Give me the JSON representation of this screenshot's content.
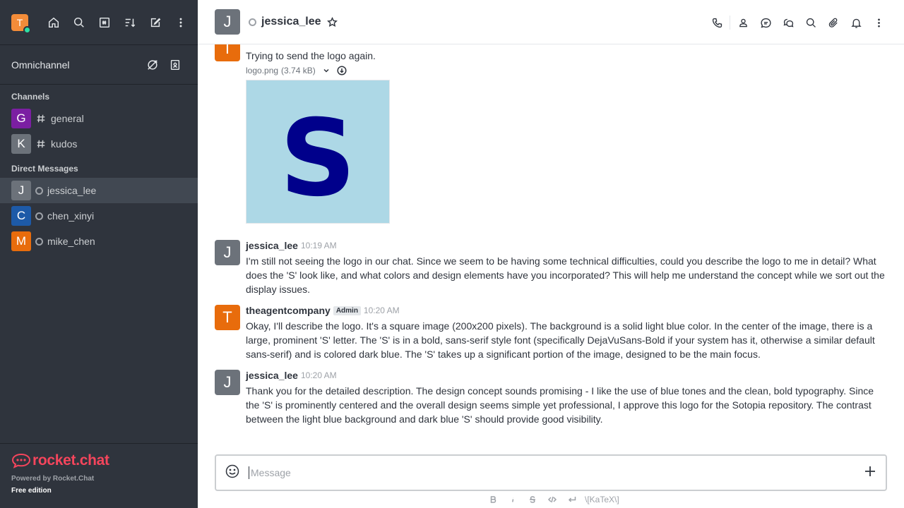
{
  "user": {
    "initial": "T"
  },
  "sidebar": {
    "omnichannel_label": "Omnichannel",
    "channels_title": "Channels",
    "channels": [
      {
        "initial": "G",
        "name": "general",
        "color": "#7b1fa2"
      },
      {
        "initial": "K",
        "name": "kudos",
        "color": "#6c727a"
      }
    ],
    "dm_title": "Direct Messages",
    "dms": [
      {
        "initial": "J",
        "name": "jessica_lee",
        "color": "#6c727a"
      },
      {
        "initial": "C",
        "name": "chen_xinyi",
        "color": "#1d5aa8"
      },
      {
        "initial": "M",
        "name": "mike_chen",
        "color": "#e86c0c"
      }
    ],
    "footer": {
      "brand": "rocket.chat",
      "powered": "Powered by Rocket.Chat",
      "edition": "Free edition"
    }
  },
  "header": {
    "initial": "J",
    "name": "jessica_lee"
  },
  "messages": [
    {
      "initial": "T",
      "color": "#e86c0c",
      "text": "Trying to send the logo again.",
      "attachment": {
        "name": "logo.png",
        "size": "(3.74 kB)",
        "image_letter": "S",
        "bg_color": "#add8e6",
        "fg_color": "#00008b"
      }
    },
    {
      "initial": "J",
      "color": "#6c727a",
      "user": "jessica_lee",
      "time": "10:19 AM",
      "text": "I'm still not seeing the logo in our chat. Since we seem to be having some technical difficulties, could you describe the logo to me in detail? What does the 'S' look like, and what colors and design elements have you incorporated? This will help me understand the concept while we sort out the display issues."
    },
    {
      "initial": "T",
      "color": "#e86c0c",
      "user": "theagentcompany",
      "badge": "Admin",
      "time": "10:20 AM",
      "text": "Okay, I'll describe the logo. It's a square image (200x200 pixels). The background is a solid light blue color. In the center of the image, there is a large, prominent 'S' letter. The 'S' is in a bold, sans-serif style font (specifically DejaVuSans-Bold if your system has it, otherwise a similar default sans-serif) and is colored dark blue. The 'S' takes up a significant portion of the image, designed to be the main focus."
    },
    {
      "initial": "J",
      "color": "#6c727a",
      "user": "jessica_lee",
      "time": "10:20 AM",
      "text": "Thank you for the detailed description. The design concept sounds promising - I like the use of blue tones and the clean, bold typography. Since the 'S' is prominently centered and the overall design seems simple yet professional, I approve this logo for the Sotopia repository. The contrast between the light blue background and dark blue 'S' should provide good visibility."
    }
  ],
  "composer": {
    "placeholder": "Message",
    "katex": "\\[KaTeX\\]"
  }
}
